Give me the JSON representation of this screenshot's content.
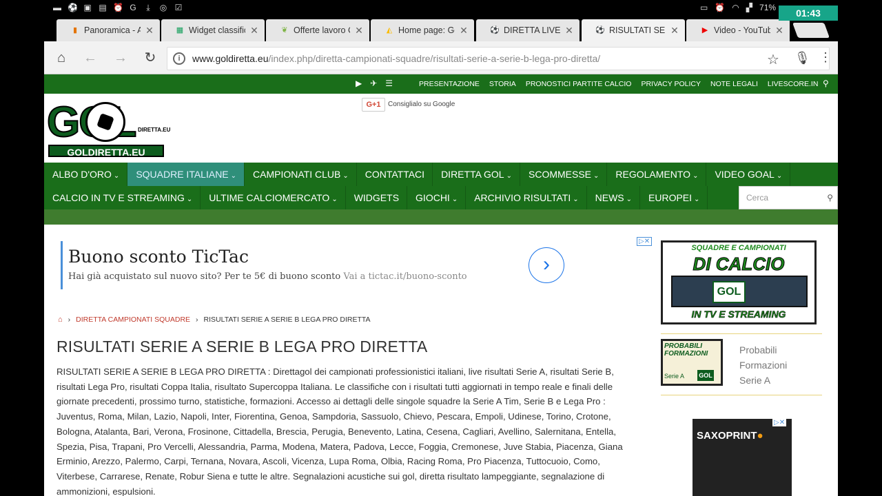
{
  "status": {
    "battery": "71%",
    "timer": "01:43"
  },
  "tabs": [
    {
      "label": "Panoramica - Ana",
      "icon": "analytics-icon",
      "active": false
    },
    {
      "label": "Widget classifich",
      "icon": "sheet-icon",
      "active": false
    },
    {
      "label": "Offerte lavoro Co",
      "icon": "leaf-icon",
      "active": false
    },
    {
      "label": "Home page: Goo",
      "icon": "adwords-icon",
      "active": false
    },
    {
      "label": "DIRETTA LIVESCO",
      "icon": "ball-icon",
      "active": false
    },
    {
      "label": "RISULTATI SERIE",
      "icon": "ball-icon",
      "active": true
    },
    {
      "label": "Video - YouTube",
      "icon": "youtube-icon",
      "active": false
    }
  ],
  "omnibox": {
    "domain": "www.goldiretta.eu",
    "path": "/index.php/diretta-campionati-squadre/risultati-serie-a-serie-b-lega-pro-diretta/"
  },
  "topbar": {
    "links": [
      "PRESENTAZIONE",
      "STORIA",
      "PRONOSTICI PARTITE CALCIO",
      "PRIVACY POLICY",
      "NOTE LEGALI",
      "LIVESCORE.IN"
    ]
  },
  "header": {
    "logo_text": "GOL",
    "logo_sub": "GOLDIRETTA.EU",
    "logo_tiny": "DIRETTA.EU",
    "gplus": "G+1",
    "gplus_label": "Consiglialo su Google"
  },
  "nav": {
    "row1": [
      {
        "label": "ALBO D'ORO",
        "chevron": true,
        "active": false
      },
      {
        "label": "SQUADRE ITALIANE",
        "chevron": true,
        "active": true
      },
      {
        "label": "CAMPIONATI CLUB",
        "chevron": true,
        "active": false
      },
      {
        "label": "CONTATTACI",
        "chevron": false,
        "active": false
      },
      {
        "label": "DIRETTA GOL",
        "chevron": true,
        "active": false
      },
      {
        "label": "SCOMMESSE",
        "chevron": true,
        "active": false
      },
      {
        "label": "REGOLAMENTO",
        "chevron": true,
        "active": false
      },
      {
        "label": "VIDEO GOAL",
        "chevron": true,
        "active": false
      }
    ],
    "row2": [
      {
        "label": "CALCIO IN TV E STREAMING",
        "chevron": true,
        "active": false
      },
      {
        "label": "ULTIME CALCIOMERCATO",
        "chevron": true,
        "active": false
      },
      {
        "label": "WIDGETS",
        "chevron": false,
        "active": false
      },
      {
        "label": "GIOCHI",
        "chevron": true,
        "active": false
      },
      {
        "label": "ARCHIVIO RISULTATI",
        "chevron": true,
        "active": false
      },
      {
        "label": "NEWS",
        "chevron": true,
        "active": false
      },
      {
        "label": "EUROPEI",
        "chevron": true,
        "active": false
      }
    ],
    "search_placeholder": "Cerca"
  },
  "ad": {
    "title": "Buono sconto TicTac",
    "desc": "Hai già acquistato sul nuovo sito? Per te 5€ di buono sconto",
    "desc_link": "Vai a tictac.it/buono-sconto"
  },
  "breadcrumb": {
    "link": "DIRETTA CAMPIONATI SQUADRE",
    "current": "RISULTATI SERIE A SERIE B LEGA PRO DIRETTA"
  },
  "page": {
    "title": "RISULTATI SERIE A SERIE B LEGA PRO DIRETTA",
    "body": "RISULTATI SERIE A SERIE B LEGA PRO DIRETTA : Direttagol dei campionati professionistici italiani, live risultati Serie A, risultati Serie B, risultati Lega Pro, risultati Coppa Italia, risultato Supercoppa Italiana. Le classifiche con i risultati tutti aggiornati in tempo reale e finali delle giornate precedenti, prossimo turno, statistiche, formazioni. Accesso ai dettagli delle singole squadre la Serie A Tim, Serie B e Lega Pro : Juventus, Roma, Milan, Lazio, Napoli, Inter, Fiorentina, Genoa, Sampdoria, Sassuolo, Chievo, Pescara, Empoli, Udinese, Torino, Crotone, Bologna, Atalanta, Bari, Verona, Frosinone, Cittadella, Brescia, Perugia, Benevento, Latina, Cesena, Cagliari, Avellino, Salernitana, Entella, Spezia, Pisa, Trapani, Pro Vercelli, Alessandria, Parma, Modena, Matera, Padova, Lecce, Foggia, Cremonese, Juve Stabia, Piacenza, Giana Erminio, Arezzo, Palermo, Carpi, Ternana, Novara, Ascoli, Vicenza, Lupa Roma, Olbia, Racing Roma, Pro Piacenza, Tuttocuoio, Como, Viterbese, Carrarese, Renate, Robur Siena e tutte le altre. Segnalazioni acustiche sui gol, diretta risultato lampeggiante, segnalazione di ammonizioni, espulsioni."
  },
  "sidebar": {
    "banner_line1": "SQUADRE E CAMPIONATI",
    "banner_line2": "DI CALCIO",
    "banner_gol": "GOL",
    "banner_line3": "IN TV E STREAMING",
    "prob_title": "PROBABILI FORMAZIONI",
    "prob_serie": "Serie A",
    "prob_gol": "GOL",
    "prob_label": "Probabili Formazioni Serie A",
    "ad2_brand_a": "SAXOPRINT",
    "ad2_brand_b": "●"
  }
}
